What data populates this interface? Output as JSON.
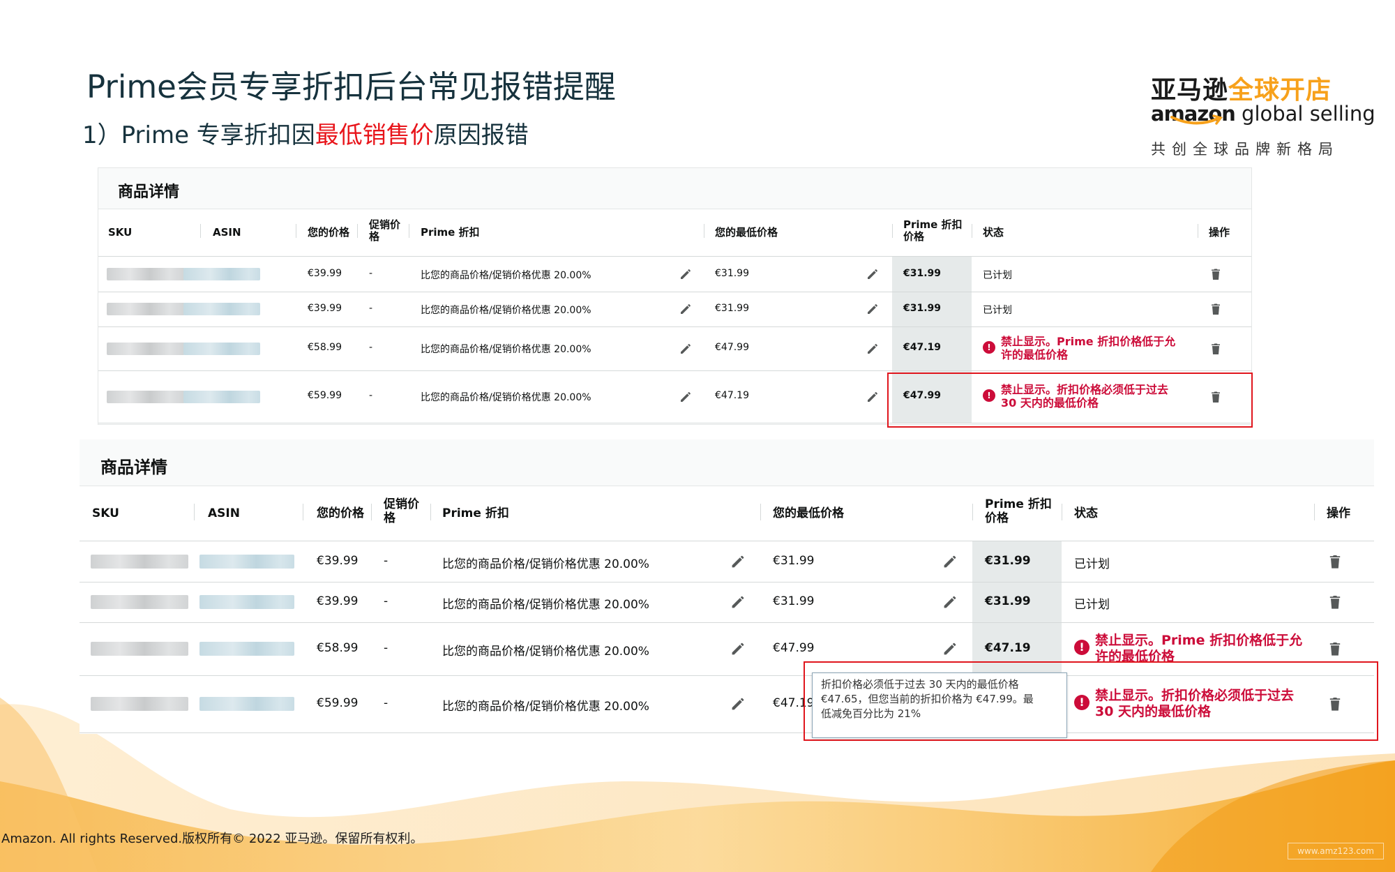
{
  "title": "Prime会员专享折扣后台常见报错提醒",
  "subtitle": {
    "prefix": "1）Prime 专享折扣因",
    "highlight": "最低销售价",
    "suffix": "原因报错"
  },
  "logo": {
    "cn_dark": "亚马逊",
    "cn_orange": "全球开店",
    "en_bold": "amazon",
    "en_light": " global selling",
    "slogan": "共创全球品牌新格局"
  },
  "colors": {
    "accent_red": "#e8151b",
    "error_red": "#cc0c39",
    "brand_orange": "#f7a11b",
    "prime_col_bg": "#e6eaea"
  },
  "table_title": "商品详情",
  "headers": {
    "sku": "SKU",
    "asin": "ASIN",
    "your_price": "您的价格",
    "promo_price": "促销价格",
    "prime_discount": "Prime 折扣",
    "min_price": "您的最低价格",
    "prime_price": "Prime 折扣价格",
    "status": "状态",
    "action": "操作"
  },
  "rows": [
    {
      "your_price": "€39.99",
      "promo": "-",
      "discount": "比您的商品价格/促销价格优惠 20.00%",
      "min_price": "€31.99",
      "prime_price": "€31.99",
      "status": "已计划"
    },
    {
      "your_price": "€39.99",
      "promo": "-",
      "discount": "比您的商品价格/促销价格优惠 20.00%",
      "min_price": "€31.99",
      "prime_price": "€31.99",
      "status": "已计划"
    },
    {
      "your_price": "€58.99",
      "promo": "-",
      "discount": "比您的商品价格/促销价格优惠 20.00%",
      "min_price": "€47.99",
      "prime_price": "€47.19",
      "error": {
        "line1": "禁止显示。Prime 折扣价格低于允",
        "line2": "许的最低价格"
      }
    },
    {
      "your_price": "€59.99",
      "promo": "-",
      "discount": "比您的商品价格/促销价格优惠 20.00%",
      "min_price": "€47.19",
      "prime_price": "€47.99",
      "error": {
        "line1": "禁止显示。折扣价格必须低于过去",
        "line2": "30 天内的最低价格"
      }
    }
  ],
  "tooltip": {
    "line1": "折扣价格必须低于过去 30 天内的最低价格",
    "line2": "€47.65，但您当前的折扣价格为 €47.99。最",
    "line3": "低减免百分比为 21%"
  },
  "icons": {
    "edit": "pencil-icon",
    "delete": "trash-icon",
    "error": "exclamation-circle-icon"
  },
  "footer": "Amazon. All rights Reserved.版权所有© 2022 亚马逊。保留所有权利。",
  "watermark": "www.amz123.com"
}
